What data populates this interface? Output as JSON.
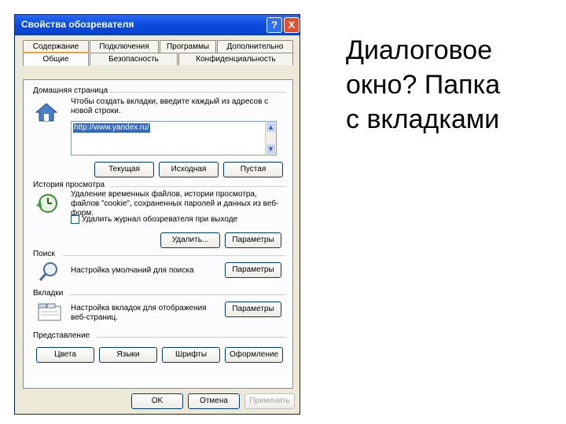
{
  "window": {
    "title": "Свойства обозревателя",
    "help_glyph": "?",
    "close_glyph": "X"
  },
  "tabs": {
    "row_back": [
      "Содержание",
      "Подключения",
      "Программы",
      "Дополнительно"
    ],
    "row_front": [
      "Общие",
      "Безопасность",
      "Конфиденциальность"
    ]
  },
  "home": {
    "group_label": "Домашняя страница",
    "description": "Чтобы создать вкладки, введите каждый из адресов с новой строки.",
    "url": "http://www.yandex.ru/",
    "buttons": [
      "Текущая",
      "Исходная",
      "Пустая"
    ]
  },
  "history": {
    "group_label": "История просмотра",
    "description": "Удаление временных файлов, истории просмотра, файлов \"cookie\", сохраненных паролей и данных из веб-форм.",
    "checkbox_label": "Удалить журнал обозревателя при выходе",
    "checkbox_checked": false,
    "delete_button": "Удалить...",
    "settings_button": "Параметры"
  },
  "search": {
    "group_label": "Поиск",
    "description": "Настройка умолчаний для поиска",
    "settings_button": "Параметры"
  },
  "tabs_group": {
    "group_label": "Вкладки",
    "description": "Настройка вкладок для отображения веб-страниц.",
    "settings_button": "Параметры"
  },
  "appearance": {
    "group_label": "Представление",
    "buttons": [
      "Цвета",
      "Языки",
      "Шрифты",
      "Оформление"
    ]
  },
  "dialog_buttons": {
    "ok": "OK",
    "cancel": "Отмена",
    "apply": "Применить"
  },
  "caption": {
    "line1": "Диалоговое",
    "line2": "окно? Папка",
    "line3": "с вкладками"
  }
}
